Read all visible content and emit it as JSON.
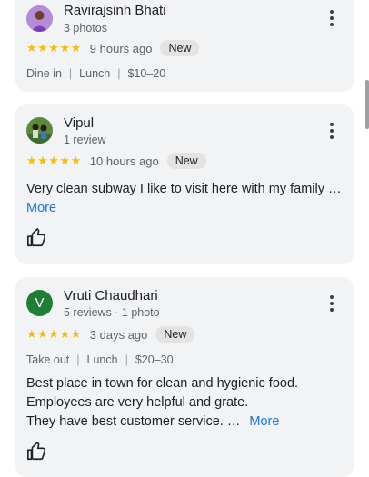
{
  "reviews": [
    {
      "reviewer_name": "Ravirajsinh Bhati",
      "reviewer_sub": "3 photos",
      "stars": "★★★★★",
      "time": "9 hours ago",
      "badge": "New",
      "meta": [
        "Dine in",
        "Lunch",
        "$10–20"
      ]
    },
    {
      "reviewer_name": "Vipul",
      "reviewer_sub": "1 review",
      "stars": "★★★★★",
      "time": "10 hours ago",
      "badge": "New",
      "text": "Very clean subway I like to visit here with my family …",
      "more": "More"
    },
    {
      "reviewer_name": "Vruti Chaudhari",
      "avatar_letter": "V",
      "reviewer_sub": "5 reviews · 1 photo",
      "stars": "★★★★★",
      "time": "3 days ago",
      "badge": "New",
      "meta": [
        "Take out",
        "Lunch",
        "$20–30"
      ],
      "text_lines": [
        "Best place in town for clean and hygienic food.",
        "Employees are very helpful and grate.",
        "They have best customer service. …"
      ],
      "more": "More"
    }
  ],
  "colors": {
    "card_bg": "#f1f3f4",
    "star": "#fbbc04",
    "link": "#1a73e8",
    "avatar_v": "#1e7e34"
  },
  "icons": {
    "menu": "more-vert-icon",
    "like": "thumb-up-icon"
  }
}
